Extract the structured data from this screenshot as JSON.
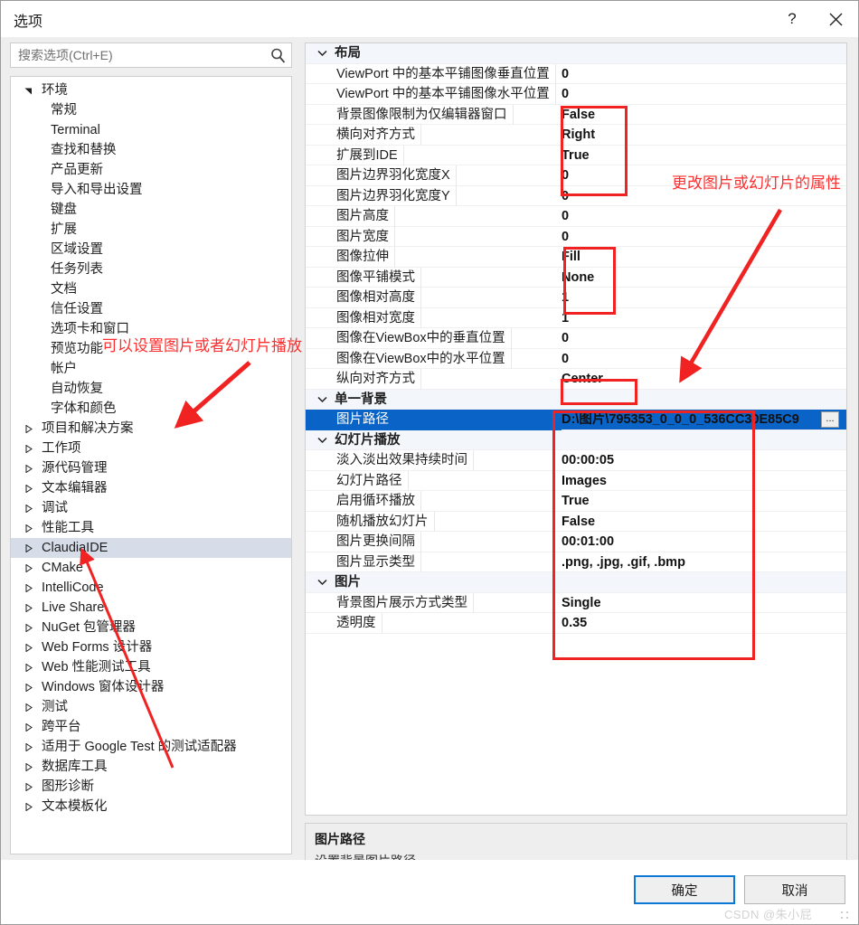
{
  "window": {
    "title": "选项",
    "help_icon": "question-mark-icon",
    "close_icon": "close-icon"
  },
  "search": {
    "placeholder": "搜索选项(Ctrl+E)",
    "value": "",
    "icon": "search-icon"
  },
  "sidebar": {
    "items": [
      {
        "label": "环境",
        "level": 1,
        "expanded": true,
        "selected": false
      },
      {
        "label": "常规",
        "level": 2,
        "expanded": false,
        "selected": false
      },
      {
        "label": "Terminal",
        "level": 2,
        "expanded": false,
        "selected": false
      },
      {
        "label": "查找和替换",
        "level": 2,
        "expanded": false,
        "selected": false
      },
      {
        "label": "产品更新",
        "level": 2,
        "expanded": false,
        "selected": false
      },
      {
        "label": "导入和导出设置",
        "level": 2,
        "expanded": false,
        "selected": false
      },
      {
        "label": "键盘",
        "level": 2,
        "expanded": false,
        "selected": false
      },
      {
        "label": "扩展",
        "level": 2,
        "expanded": false,
        "selected": false
      },
      {
        "label": "区域设置",
        "level": 2,
        "expanded": false,
        "selected": false
      },
      {
        "label": "任务列表",
        "level": 2,
        "expanded": false,
        "selected": false
      },
      {
        "label": "文档",
        "level": 2,
        "expanded": false,
        "selected": false
      },
      {
        "label": "信任设置",
        "level": 2,
        "expanded": false,
        "selected": false
      },
      {
        "label": "选项卡和窗口",
        "level": 2,
        "expanded": false,
        "selected": false
      },
      {
        "label": "预览功能",
        "level": 2,
        "expanded": false,
        "selected": false
      },
      {
        "label": "帐户",
        "level": 2,
        "expanded": false,
        "selected": false
      },
      {
        "label": "自动恢复",
        "level": 2,
        "expanded": false,
        "selected": false
      },
      {
        "label": "字体和颜色",
        "level": 2,
        "expanded": false,
        "selected": false
      },
      {
        "label": "项目和解决方案",
        "level": 1,
        "expanded": false,
        "selected": false
      },
      {
        "label": "工作项",
        "level": 1,
        "expanded": false,
        "selected": false
      },
      {
        "label": "源代码管理",
        "level": 1,
        "expanded": false,
        "selected": false
      },
      {
        "label": "文本编辑器",
        "level": 1,
        "expanded": false,
        "selected": false
      },
      {
        "label": "调试",
        "level": 1,
        "expanded": false,
        "selected": false
      },
      {
        "label": "性能工具",
        "level": 1,
        "expanded": false,
        "selected": false
      },
      {
        "label": "ClaudiaIDE",
        "level": 1,
        "expanded": false,
        "selected": true
      },
      {
        "label": "CMake",
        "level": 1,
        "expanded": false,
        "selected": false
      },
      {
        "label": "IntelliCode",
        "level": 1,
        "expanded": false,
        "selected": false
      },
      {
        "label": "Live Share",
        "level": 1,
        "expanded": false,
        "selected": false
      },
      {
        "label": "NuGet 包管理器",
        "level": 1,
        "expanded": false,
        "selected": false
      },
      {
        "label": "Web Forms 设计器",
        "level": 1,
        "expanded": false,
        "selected": false
      },
      {
        "label": "Web 性能测试工具",
        "level": 1,
        "expanded": false,
        "selected": false
      },
      {
        "label": "Windows 窗体设计器",
        "level": 1,
        "expanded": false,
        "selected": false
      },
      {
        "label": "测试",
        "level": 1,
        "expanded": false,
        "selected": false
      },
      {
        "label": "跨平台",
        "level": 1,
        "expanded": false,
        "selected": false
      },
      {
        "label": "适用于 Google Test 的测试适配器",
        "level": 1,
        "expanded": false,
        "selected": false
      },
      {
        "label": "数据库工具",
        "level": 1,
        "expanded": false,
        "selected": false
      },
      {
        "label": "图形诊断",
        "level": 1,
        "expanded": false,
        "selected": false
      },
      {
        "label": "文本模板化",
        "level": 1,
        "expanded": false,
        "selected": false
      }
    ]
  },
  "property_grid": {
    "rows": [
      {
        "type": "category",
        "name": "布局",
        "value": "",
        "expanded": true
      },
      {
        "type": "prop",
        "name": "ViewPort 中的基本平铺图像垂直位置",
        "value": "0",
        "wide": true
      },
      {
        "type": "prop",
        "name": "ViewPort 中的基本平铺图像水平位置",
        "value": "0",
        "wide": true
      },
      {
        "type": "prop",
        "name": "背景图像限制为仅编辑器窗口",
        "value": "False"
      },
      {
        "type": "prop",
        "name": "横向对齐方式",
        "value": "Right"
      },
      {
        "type": "prop",
        "name": "扩展到IDE",
        "value": "True"
      },
      {
        "type": "prop",
        "name": "图片边界羽化宽度X",
        "value": "0"
      },
      {
        "type": "prop",
        "name": "图片边界羽化宽度Y",
        "value": "0"
      },
      {
        "type": "prop",
        "name": "图片高度",
        "value": "0"
      },
      {
        "type": "prop",
        "name": "图片宽度",
        "value": "0"
      },
      {
        "type": "prop",
        "name": "图像拉伸",
        "value": "Fill"
      },
      {
        "type": "prop",
        "name": "图像平铺模式",
        "value": "None"
      },
      {
        "type": "prop",
        "name": "图像相对高度",
        "value": "1"
      },
      {
        "type": "prop",
        "name": "图像相对宽度",
        "value": "1"
      },
      {
        "type": "prop",
        "name": "图像在ViewBox中的垂直位置",
        "value": "0"
      },
      {
        "type": "prop",
        "name": "图像在ViewBox中的水平位置",
        "value": "0"
      },
      {
        "type": "prop",
        "name": "纵向对齐方式",
        "value": "Center"
      },
      {
        "type": "category",
        "name": "单一背景",
        "value": "",
        "expanded": true
      },
      {
        "type": "prop",
        "name": "图片路径",
        "value": "D:\\图片\\795353_0_0_0_536CC30E85C9",
        "selected": true,
        "has_ellipsis": true,
        "ellipsis_label": "..."
      },
      {
        "type": "category",
        "name": "幻灯片播放",
        "value": "",
        "expanded": true
      },
      {
        "type": "prop",
        "name": "淡入淡出效果持续时间",
        "value": "00:00:05"
      },
      {
        "type": "prop",
        "name": "幻灯片路径",
        "value": "Images"
      },
      {
        "type": "prop",
        "name": "启用循环播放",
        "value": "True"
      },
      {
        "type": "prop",
        "name": "随机播放幻灯片",
        "value": "False"
      },
      {
        "type": "prop",
        "name": "图片更换间隔",
        "value": "00:01:00"
      },
      {
        "type": "prop",
        "name": "图片显示类型",
        "value": ".png, .jpg, .gif, .bmp"
      },
      {
        "type": "category",
        "name": "图片",
        "value": "",
        "expanded": true
      },
      {
        "type": "prop",
        "name": "背景图片展示方式类型",
        "value": "Single"
      },
      {
        "type": "prop",
        "name": "透明度",
        "value": "0.35"
      }
    ]
  },
  "description": {
    "title": "图片路径",
    "text": "设置背景图片路径"
  },
  "footer": {
    "ok_label": "确定",
    "cancel_label": "取消"
  },
  "annotations": {
    "left_note": "可以设置图片或者幻灯片播放",
    "right_note": "更改图片或幻灯片的属性",
    "color": "#fb2f2f"
  },
  "watermark": {
    "text": "CSDN @朱小屁"
  }
}
